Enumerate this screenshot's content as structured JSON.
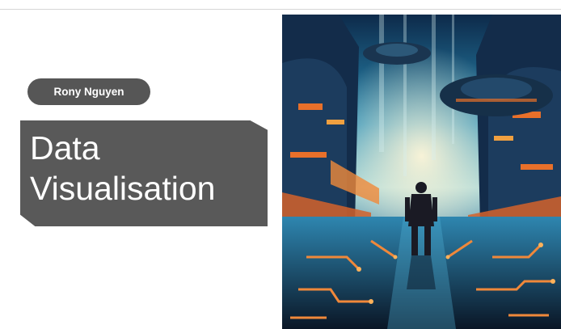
{
  "slide": {
    "author": "Rony Nguyen",
    "title_lines": [
      "Data",
      "Visualisation"
    ]
  },
  "hero_image": {
    "subject": "sci-fi city corridor with lone figure",
    "colors": {
      "sky_top": "#0d2a4a",
      "sky_mid": "#2a8fb8",
      "glow": "#e8f1d8",
      "orange": "#e8702a",
      "dark": "#0b1a2e"
    }
  }
}
